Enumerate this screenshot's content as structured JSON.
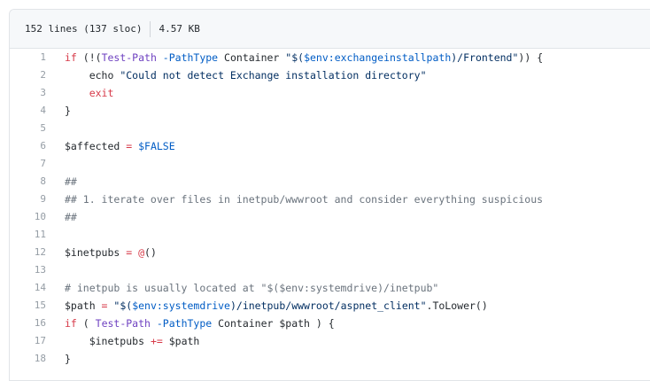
{
  "header": {
    "lines_label": "152 lines (137 sloc)",
    "size_label": "4.57 KB"
  },
  "code": [
    {
      "n": "1",
      "tokens": [
        [
          "k",
          "if"
        ],
        [
          "v",
          " (!("
        ],
        [
          "f",
          "Test-Path"
        ],
        [
          "p",
          " -PathType"
        ],
        [
          "v",
          " Container "
        ],
        [
          "s",
          "\"$("
        ],
        [
          "e",
          "$env:exchangeinstallpath"
        ],
        [
          "s",
          ")/Frontend\""
        ],
        [
          "v",
          ")) {"
        ]
      ]
    },
    {
      "n": "2",
      "tokens": [
        [
          "v",
          "    echo "
        ],
        [
          "s",
          "\"Could not detect Exchange installation directory\""
        ]
      ]
    },
    {
      "n": "3",
      "tokens": [
        [
          "v",
          "    "
        ],
        [
          "k",
          "exit"
        ]
      ]
    },
    {
      "n": "4",
      "tokens": [
        [
          "v",
          "}"
        ]
      ]
    },
    {
      "n": "5",
      "tokens": []
    },
    {
      "n": "6",
      "tokens": [
        [
          "v",
          "$affected"
        ],
        [
          "o",
          " ="
        ],
        [
          "e",
          " $FALSE"
        ]
      ]
    },
    {
      "n": "7",
      "tokens": []
    },
    {
      "n": "8",
      "tokens": [
        [
          "c",
          "##"
        ]
      ]
    },
    {
      "n": "9",
      "tokens": [
        [
          "c",
          "## 1. iterate over files in inetpub/wwwroot and consider everything suspicious"
        ]
      ]
    },
    {
      "n": "10",
      "tokens": [
        [
          "c",
          "##"
        ]
      ]
    },
    {
      "n": "11",
      "tokens": []
    },
    {
      "n": "12",
      "tokens": [
        [
          "v",
          "$inetpubs"
        ],
        [
          "o",
          " ="
        ],
        [
          "k",
          " @"
        ],
        [
          "v",
          "()"
        ]
      ]
    },
    {
      "n": "13",
      "tokens": []
    },
    {
      "n": "14",
      "tokens": [
        [
          "c",
          "# inetpub is usually located at \"$($env:systemdrive)/inetpub\""
        ]
      ]
    },
    {
      "n": "15",
      "tokens": [
        [
          "v",
          "$path"
        ],
        [
          "o",
          " ="
        ],
        [
          "s",
          " \"$("
        ],
        [
          "e",
          "$env:systemdrive"
        ],
        [
          "s",
          ")/inetpub/wwwroot/aspnet_client\""
        ],
        [
          "v",
          ".ToLower()"
        ]
      ]
    },
    {
      "n": "16",
      "tokens": [
        [
          "k",
          "if"
        ],
        [
          "v",
          " ( "
        ],
        [
          "f",
          "Test-Path"
        ],
        [
          "p",
          " -PathType"
        ],
        [
          "v",
          " Container $path ) {"
        ]
      ]
    },
    {
      "n": "17",
      "tokens": [
        [
          "v",
          "    $inetpubs"
        ],
        [
          "o",
          " +="
        ],
        [
          "v",
          " $path"
        ]
      ]
    },
    {
      "n": "18",
      "tokens": [
        [
          "v",
          "}"
        ]
      ]
    }
  ]
}
